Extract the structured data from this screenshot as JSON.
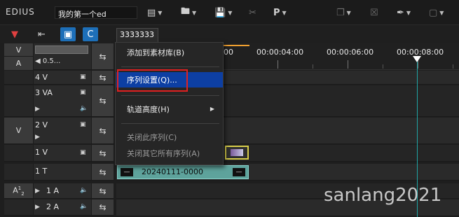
{
  "app": {
    "name": "EDIUS",
    "project_name": "我的第一个ed"
  },
  "toolbar": {
    "items": [
      {
        "id": "sequence-settings",
        "icon": "sequence-icon",
        "label": ""
      },
      {
        "id": "open",
        "icon": "folder-icon",
        "label": ""
      },
      {
        "id": "save",
        "icon": "save-icon",
        "label": ""
      },
      {
        "id": "cut",
        "icon": "scissors-icon",
        "label": ""
      },
      {
        "id": "paste",
        "icon": "paste-icon",
        "label": "P"
      },
      {
        "id": "copy",
        "icon": "copy-icon",
        "label": ""
      },
      {
        "id": "delete",
        "icon": "delete-icon",
        "label": ""
      },
      {
        "id": "add-marker",
        "icon": "marker-icon",
        "label": ""
      },
      {
        "id": "crop",
        "icon": "crop-icon",
        "label": ""
      }
    ]
  },
  "sequence_tab": {
    "label": "3333333"
  },
  "patch_row": {
    "v": "V",
    "a": "A",
    "zoom": "0.5..."
  },
  "tracks": [
    {
      "name": "4 V",
      "patch": ""
    },
    {
      "name": "3 VA",
      "patch": ""
    },
    {
      "name": "2 V",
      "patch": "V"
    },
    {
      "name": "1 V",
      "patch": ""
    },
    {
      "name": "1 T",
      "patch": ""
    },
    {
      "name": "1 A",
      "patch": "A12"
    },
    {
      "name": "2 A",
      "patch": ""
    }
  ],
  "ruler": {
    "labels": [
      "00",
      "00:00:04:00",
      "00:00:06:00",
      "00:00:08:00"
    ]
  },
  "clips": {
    "title_clip": "20240111-0000"
  },
  "context_menu": {
    "items": [
      {
        "label": "添加到素材库(B)",
        "state": "normal"
      },
      {
        "label": "序列设置(Q)...",
        "state": "selected"
      },
      {
        "label": "轨道高度(H)",
        "state": "submenu"
      },
      {
        "label": "关闭此序列(C)",
        "state": "disabled"
      },
      {
        "label": "关闭其它所有序列(A)",
        "state": "disabled"
      }
    ]
  },
  "colors": {
    "menu_highlight": "#0d3fa3",
    "annotation_box": "#e02020",
    "playhead": "#1fa6a6",
    "title_clip": "#5ea39c",
    "video_clip_border": "#d7cd4a"
  },
  "watermark": "sanlang2021"
}
